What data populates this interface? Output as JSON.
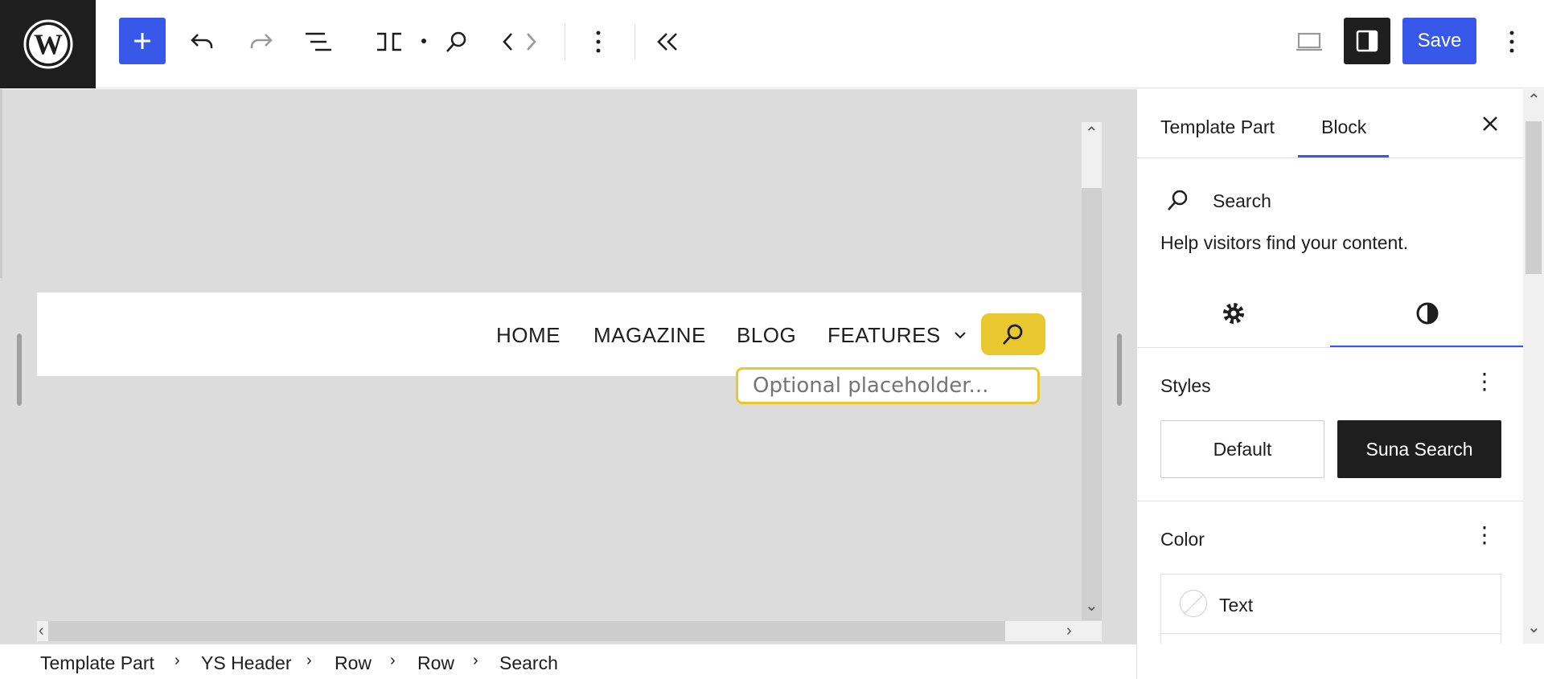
{
  "toolbar": {
    "save_label": "Save",
    "icons": [
      "wordpress-logo",
      "plus-icon",
      "undo-icon",
      "redo-icon",
      "list-view-icon",
      "template-part-icon",
      "search-icon",
      "code-icon",
      "more-vertical-icon",
      "collapse-icon",
      "desktop-icon",
      "settings-sidebar-icon"
    ]
  },
  "canvas": {
    "nav": [
      "HOME",
      "MAGAZINE",
      "BLOG",
      "FEATURES"
    ],
    "search_placeholder": "Optional placeholder..."
  },
  "breadcrumb": [
    "Template Part",
    "YS Header",
    "Row",
    "Row",
    "Search"
  ],
  "sidebar": {
    "tabs": [
      "Template Part",
      "Block"
    ],
    "active_tab": "Block",
    "block_name": "Search",
    "block_description": "Help visitors find your content.",
    "active_subtab": "styles",
    "styles_title": "Styles",
    "style_options": [
      "Default",
      "Suna Search"
    ],
    "active_style": "Suna Search",
    "color_title": "Color",
    "color_items": [
      "Text"
    ]
  },
  "colors": {
    "accent": "#3858e9",
    "search_yellow": "#e8c82e",
    "dark": "#1e1e1e"
  }
}
